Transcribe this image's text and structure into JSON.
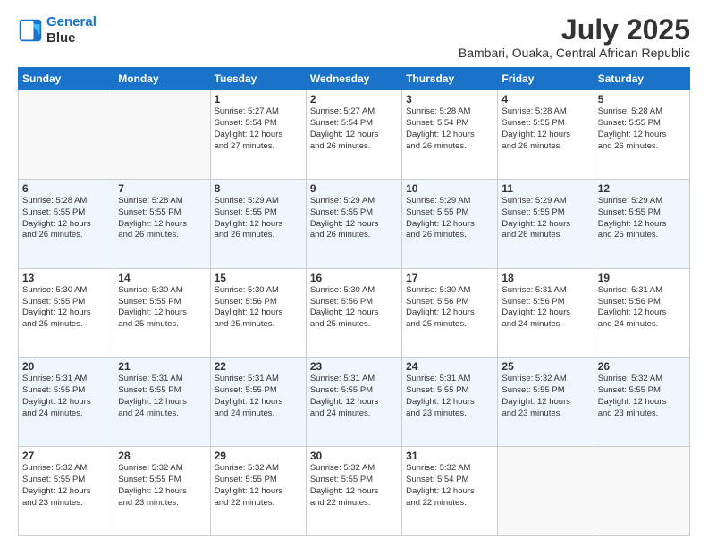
{
  "logo": {
    "line1": "General",
    "line2": "Blue"
  },
  "title": "July 2025",
  "subtitle": "Bambari, Ouaka, Central African Republic",
  "header_days": [
    "Sunday",
    "Monday",
    "Tuesday",
    "Wednesday",
    "Thursday",
    "Friday",
    "Saturday"
  ],
  "weeks": [
    [
      {
        "day": "",
        "info": ""
      },
      {
        "day": "",
        "info": ""
      },
      {
        "day": "1",
        "info": "Sunrise: 5:27 AM\nSunset: 5:54 PM\nDaylight: 12 hours\nand 27 minutes."
      },
      {
        "day": "2",
        "info": "Sunrise: 5:27 AM\nSunset: 5:54 PM\nDaylight: 12 hours\nand 26 minutes."
      },
      {
        "day": "3",
        "info": "Sunrise: 5:28 AM\nSunset: 5:54 PM\nDaylight: 12 hours\nand 26 minutes."
      },
      {
        "day": "4",
        "info": "Sunrise: 5:28 AM\nSunset: 5:55 PM\nDaylight: 12 hours\nand 26 minutes."
      },
      {
        "day": "5",
        "info": "Sunrise: 5:28 AM\nSunset: 5:55 PM\nDaylight: 12 hours\nand 26 minutes."
      }
    ],
    [
      {
        "day": "6",
        "info": "Sunrise: 5:28 AM\nSunset: 5:55 PM\nDaylight: 12 hours\nand 26 minutes."
      },
      {
        "day": "7",
        "info": "Sunrise: 5:28 AM\nSunset: 5:55 PM\nDaylight: 12 hours\nand 26 minutes."
      },
      {
        "day": "8",
        "info": "Sunrise: 5:29 AM\nSunset: 5:55 PM\nDaylight: 12 hours\nand 26 minutes."
      },
      {
        "day": "9",
        "info": "Sunrise: 5:29 AM\nSunset: 5:55 PM\nDaylight: 12 hours\nand 26 minutes."
      },
      {
        "day": "10",
        "info": "Sunrise: 5:29 AM\nSunset: 5:55 PM\nDaylight: 12 hours\nand 26 minutes."
      },
      {
        "day": "11",
        "info": "Sunrise: 5:29 AM\nSunset: 5:55 PM\nDaylight: 12 hours\nand 26 minutes."
      },
      {
        "day": "12",
        "info": "Sunrise: 5:29 AM\nSunset: 5:55 PM\nDaylight: 12 hours\nand 25 minutes."
      }
    ],
    [
      {
        "day": "13",
        "info": "Sunrise: 5:30 AM\nSunset: 5:55 PM\nDaylight: 12 hours\nand 25 minutes."
      },
      {
        "day": "14",
        "info": "Sunrise: 5:30 AM\nSunset: 5:55 PM\nDaylight: 12 hours\nand 25 minutes."
      },
      {
        "day": "15",
        "info": "Sunrise: 5:30 AM\nSunset: 5:56 PM\nDaylight: 12 hours\nand 25 minutes."
      },
      {
        "day": "16",
        "info": "Sunrise: 5:30 AM\nSunset: 5:56 PM\nDaylight: 12 hours\nand 25 minutes."
      },
      {
        "day": "17",
        "info": "Sunrise: 5:30 AM\nSunset: 5:56 PM\nDaylight: 12 hours\nand 25 minutes."
      },
      {
        "day": "18",
        "info": "Sunrise: 5:31 AM\nSunset: 5:56 PM\nDaylight: 12 hours\nand 24 minutes."
      },
      {
        "day": "19",
        "info": "Sunrise: 5:31 AM\nSunset: 5:56 PM\nDaylight: 12 hours\nand 24 minutes."
      }
    ],
    [
      {
        "day": "20",
        "info": "Sunrise: 5:31 AM\nSunset: 5:55 PM\nDaylight: 12 hours\nand 24 minutes."
      },
      {
        "day": "21",
        "info": "Sunrise: 5:31 AM\nSunset: 5:55 PM\nDaylight: 12 hours\nand 24 minutes."
      },
      {
        "day": "22",
        "info": "Sunrise: 5:31 AM\nSunset: 5:55 PM\nDaylight: 12 hours\nand 24 minutes."
      },
      {
        "day": "23",
        "info": "Sunrise: 5:31 AM\nSunset: 5:55 PM\nDaylight: 12 hours\nand 24 minutes."
      },
      {
        "day": "24",
        "info": "Sunrise: 5:31 AM\nSunset: 5:55 PM\nDaylight: 12 hours\nand 23 minutes."
      },
      {
        "day": "25",
        "info": "Sunrise: 5:32 AM\nSunset: 5:55 PM\nDaylight: 12 hours\nand 23 minutes."
      },
      {
        "day": "26",
        "info": "Sunrise: 5:32 AM\nSunset: 5:55 PM\nDaylight: 12 hours\nand 23 minutes."
      }
    ],
    [
      {
        "day": "27",
        "info": "Sunrise: 5:32 AM\nSunset: 5:55 PM\nDaylight: 12 hours\nand 23 minutes."
      },
      {
        "day": "28",
        "info": "Sunrise: 5:32 AM\nSunset: 5:55 PM\nDaylight: 12 hours\nand 23 minutes."
      },
      {
        "day": "29",
        "info": "Sunrise: 5:32 AM\nSunset: 5:55 PM\nDaylight: 12 hours\nand 22 minutes."
      },
      {
        "day": "30",
        "info": "Sunrise: 5:32 AM\nSunset: 5:55 PM\nDaylight: 12 hours\nand 22 minutes."
      },
      {
        "day": "31",
        "info": "Sunrise: 5:32 AM\nSunset: 5:54 PM\nDaylight: 12 hours\nand 22 minutes."
      },
      {
        "day": "",
        "info": ""
      },
      {
        "day": "",
        "info": ""
      }
    ]
  ]
}
